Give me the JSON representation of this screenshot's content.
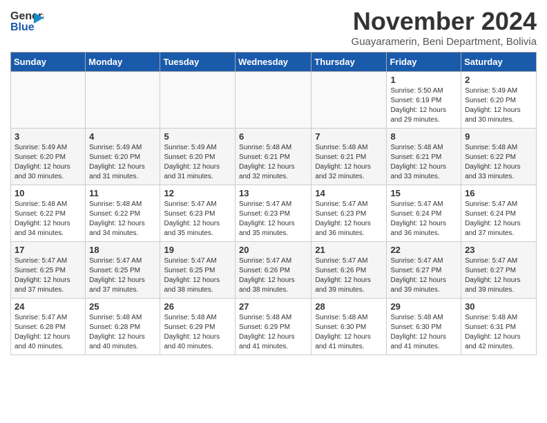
{
  "logo": {
    "line1": "General",
    "line2": "Blue",
    "arrow": "▶"
  },
  "title": "November 2024",
  "location": "Guayaramerin, Beni Department, Bolivia",
  "headers": [
    "Sunday",
    "Monday",
    "Tuesday",
    "Wednesday",
    "Thursday",
    "Friday",
    "Saturday"
  ],
  "weeks": [
    [
      {
        "day": "",
        "info": ""
      },
      {
        "day": "",
        "info": ""
      },
      {
        "day": "",
        "info": ""
      },
      {
        "day": "",
        "info": ""
      },
      {
        "day": "",
        "info": ""
      },
      {
        "day": "1",
        "info": "Sunrise: 5:50 AM\nSunset: 6:19 PM\nDaylight: 12 hours and 29 minutes."
      },
      {
        "day": "2",
        "info": "Sunrise: 5:49 AM\nSunset: 6:20 PM\nDaylight: 12 hours and 30 minutes."
      }
    ],
    [
      {
        "day": "3",
        "info": "Sunrise: 5:49 AM\nSunset: 6:20 PM\nDaylight: 12 hours and 30 minutes."
      },
      {
        "day": "4",
        "info": "Sunrise: 5:49 AM\nSunset: 6:20 PM\nDaylight: 12 hours and 31 minutes."
      },
      {
        "day": "5",
        "info": "Sunrise: 5:49 AM\nSunset: 6:20 PM\nDaylight: 12 hours and 31 minutes."
      },
      {
        "day": "6",
        "info": "Sunrise: 5:48 AM\nSunset: 6:21 PM\nDaylight: 12 hours and 32 minutes."
      },
      {
        "day": "7",
        "info": "Sunrise: 5:48 AM\nSunset: 6:21 PM\nDaylight: 12 hours and 32 minutes."
      },
      {
        "day": "8",
        "info": "Sunrise: 5:48 AM\nSunset: 6:21 PM\nDaylight: 12 hours and 33 minutes."
      },
      {
        "day": "9",
        "info": "Sunrise: 5:48 AM\nSunset: 6:22 PM\nDaylight: 12 hours and 33 minutes."
      }
    ],
    [
      {
        "day": "10",
        "info": "Sunrise: 5:48 AM\nSunset: 6:22 PM\nDaylight: 12 hours and 34 minutes."
      },
      {
        "day": "11",
        "info": "Sunrise: 5:48 AM\nSunset: 6:22 PM\nDaylight: 12 hours and 34 minutes."
      },
      {
        "day": "12",
        "info": "Sunrise: 5:47 AM\nSunset: 6:23 PM\nDaylight: 12 hours and 35 minutes."
      },
      {
        "day": "13",
        "info": "Sunrise: 5:47 AM\nSunset: 6:23 PM\nDaylight: 12 hours and 35 minutes."
      },
      {
        "day": "14",
        "info": "Sunrise: 5:47 AM\nSunset: 6:23 PM\nDaylight: 12 hours and 36 minutes."
      },
      {
        "day": "15",
        "info": "Sunrise: 5:47 AM\nSunset: 6:24 PM\nDaylight: 12 hours and 36 minutes."
      },
      {
        "day": "16",
        "info": "Sunrise: 5:47 AM\nSunset: 6:24 PM\nDaylight: 12 hours and 37 minutes."
      }
    ],
    [
      {
        "day": "17",
        "info": "Sunrise: 5:47 AM\nSunset: 6:25 PM\nDaylight: 12 hours and 37 minutes."
      },
      {
        "day": "18",
        "info": "Sunrise: 5:47 AM\nSunset: 6:25 PM\nDaylight: 12 hours and 37 minutes."
      },
      {
        "day": "19",
        "info": "Sunrise: 5:47 AM\nSunset: 6:25 PM\nDaylight: 12 hours and 38 minutes."
      },
      {
        "day": "20",
        "info": "Sunrise: 5:47 AM\nSunset: 6:26 PM\nDaylight: 12 hours and 38 minutes."
      },
      {
        "day": "21",
        "info": "Sunrise: 5:47 AM\nSunset: 6:26 PM\nDaylight: 12 hours and 39 minutes."
      },
      {
        "day": "22",
        "info": "Sunrise: 5:47 AM\nSunset: 6:27 PM\nDaylight: 12 hours and 39 minutes."
      },
      {
        "day": "23",
        "info": "Sunrise: 5:47 AM\nSunset: 6:27 PM\nDaylight: 12 hours and 39 minutes."
      }
    ],
    [
      {
        "day": "24",
        "info": "Sunrise: 5:47 AM\nSunset: 6:28 PM\nDaylight: 12 hours and 40 minutes."
      },
      {
        "day": "25",
        "info": "Sunrise: 5:48 AM\nSunset: 6:28 PM\nDaylight: 12 hours and 40 minutes."
      },
      {
        "day": "26",
        "info": "Sunrise: 5:48 AM\nSunset: 6:29 PM\nDaylight: 12 hours and 40 minutes."
      },
      {
        "day": "27",
        "info": "Sunrise: 5:48 AM\nSunset: 6:29 PM\nDaylight: 12 hours and 41 minutes."
      },
      {
        "day": "28",
        "info": "Sunrise: 5:48 AM\nSunset: 6:30 PM\nDaylight: 12 hours and 41 minutes."
      },
      {
        "day": "29",
        "info": "Sunrise: 5:48 AM\nSunset: 6:30 PM\nDaylight: 12 hours and 41 minutes."
      },
      {
        "day": "30",
        "info": "Sunrise: 5:48 AM\nSunset: 6:31 PM\nDaylight: 12 hours and 42 minutes."
      }
    ]
  ]
}
